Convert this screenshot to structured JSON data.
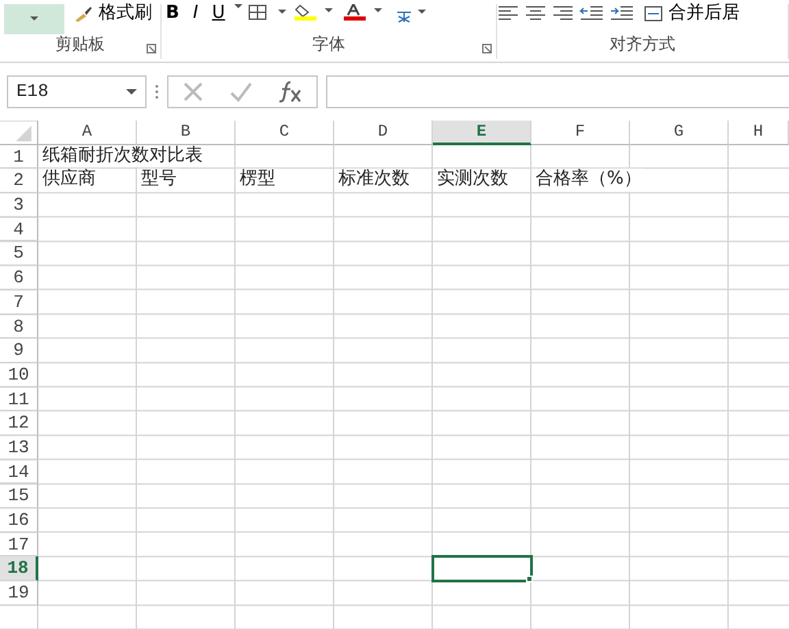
{
  "ribbon": {
    "format_painter": "格式刷",
    "font_buttons": [
      "B",
      "I",
      "U"
    ],
    "merge_button": "合并后居",
    "groups": [
      {
        "label": "剪贴板",
        "launcher": true
      },
      {
        "label": "字体",
        "launcher": true
      },
      {
        "label": "对齐方式",
        "launcher": false
      }
    ]
  },
  "formula_bar": {
    "name_box": "E18"
  },
  "sheet": {
    "columns": [
      {
        "label": "A",
        "selected": false
      },
      {
        "label": "B",
        "selected": false
      },
      {
        "label": "C",
        "selected": false
      },
      {
        "label": "D",
        "selected": false
      },
      {
        "label": "E",
        "selected": true
      },
      {
        "label": "F",
        "selected": false
      },
      {
        "label": "G",
        "selected": false
      },
      {
        "label": "H",
        "selected": false
      }
    ],
    "rows": [
      {
        "label": "1",
        "selected": false,
        "cells": [
          "纸箱耐折次数对比表"
        ]
      },
      {
        "label": "2",
        "selected": false,
        "cells": [
          "供应商",
          "型号",
          "楞型",
          "标准次数",
          "实测次数",
          "合格率（%）"
        ]
      },
      {
        "label": "3",
        "selected": false
      },
      {
        "label": "4",
        "selected": false
      },
      {
        "label": "5",
        "selected": false
      },
      {
        "label": "6",
        "selected": false
      },
      {
        "label": "7",
        "selected": false
      },
      {
        "label": "8",
        "selected": false
      },
      {
        "label": "9",
        "selected": false
      },
      {
        "label": "10",
        "selected": false
      },
      {
        "label": "11",
        "selected": false
      },
      {
        "label": "12",
        "selected": false
      },
      {
        "label": "13",
        "selected": false
      },
      {
        "label": "14",
        "selected": false
      },
      {
        "label": "15",
        "selected": false
      },
      {
        "label": "16",
        "selected": false
      },
      {
        "label": "17",
        "selected": false
      },
      {
        "label": "18",
        "selected": true
      },
      {
        "label": "19",
        "selected": false
      }
    ]
  }
}
